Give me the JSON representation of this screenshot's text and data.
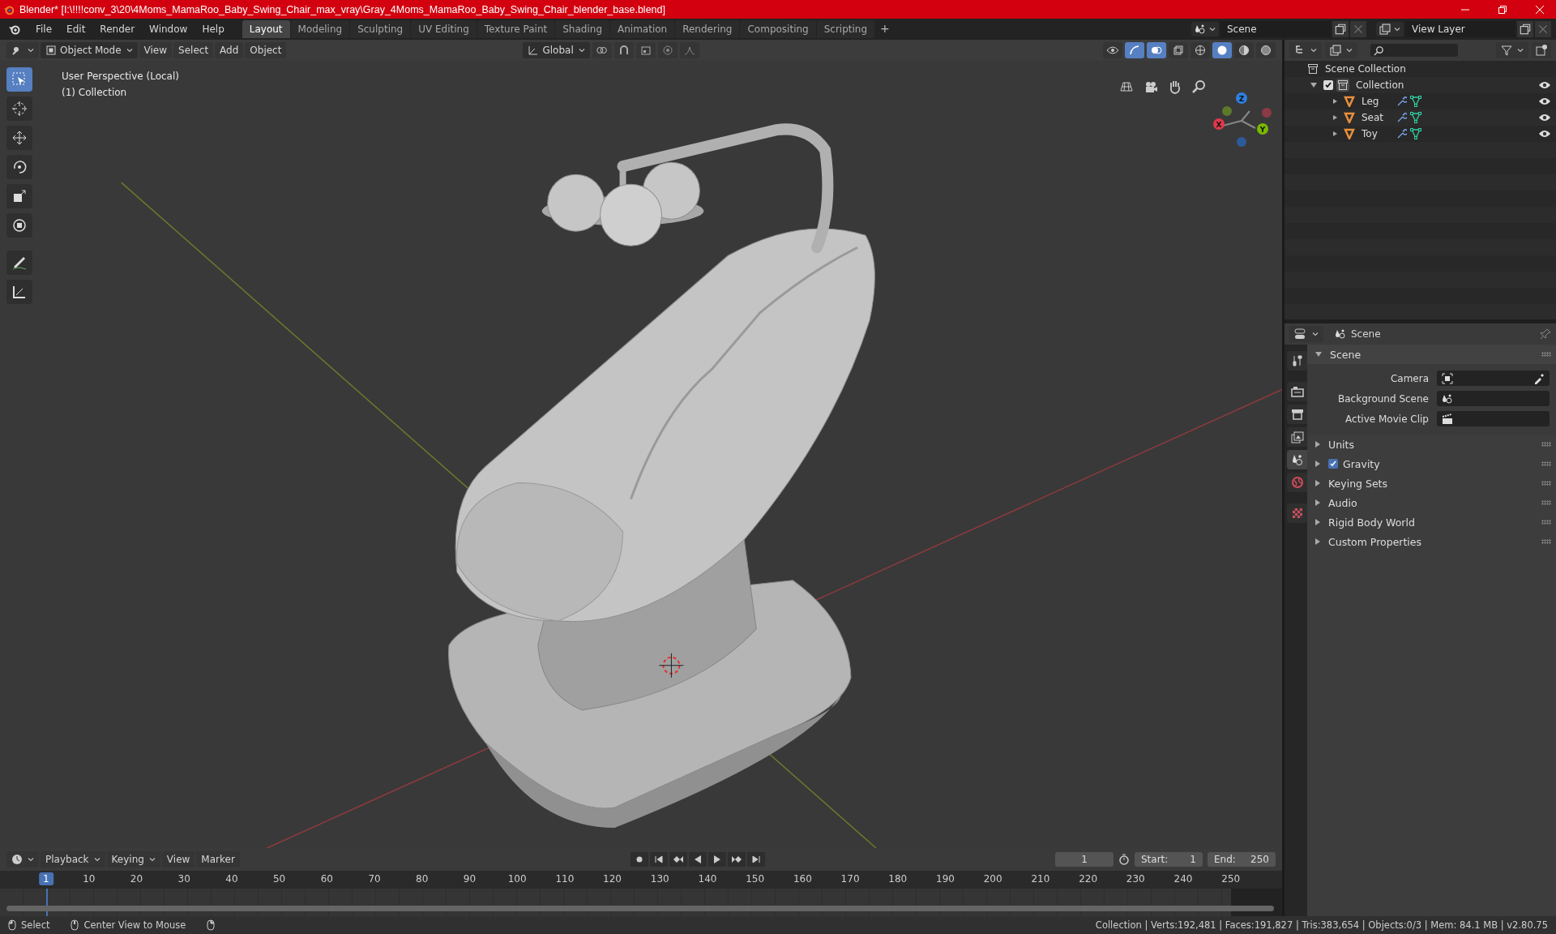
{
  "title_bar": {
    "title": "Blender* [I:\\!!!!conv_3\\20\\4Moms_MamaRoo_Baby_Swing_Chair_max_vray\\Gray_4Moms_MamaRoo_Baby_Swing_Chair_blender_base.blend]"
  },
  "menu": [
    "File",
    "Edit",
    "Render",
    "Window",
    "Help"
  ],
  "workspaces": [
    {
      "label": "Layout",
      "selected": true
    },
    {
      "label": "Modeling",
      "selected": false
    },
    {
      "label": "Sculpting",
      "selected": false
    },
    {
      "label": "UV Editing",
      "selected": false
    },
    {
      "label": "Texture Paint",
      "selected": false
    },
    {
      "label": "Shading",
      "selected": false
    },
    {
      "label": "Animation",
      "selected": false
    },
    {
      "label": "Rendering",
      "selected": false
    },
    {
      "label": "Compositing",
      "selected": false
    },
    {
      "label": "Scripting",
      "selected": false
    }
  ],
  "add_workspace": "+",
  "scene_field": {
    "value": "Scene"
  },
  "view_layer_field": {
    "value": "View Layer"
  },
  "viewport_header": {
    "mode": "Object Mode",
    "menus": [
      "View",
      "Select",
      "Add",
      "Object"
    ],
    "orientation": "Global"
  },
  "viewport": {
    "perspective": "User Perspective (Local)",
    "collection": "(1) Collection",
    "gizmo": {
      "x": "X",
      "y": "Y",
      "z": "Z"
    }
  },
  "toolbar": [
    {
      "kind": "select",
      "selected": true
    },
    {
      "kind": "cursor",
      "selected": false
    },
    {
      "kind": "move",
      "selected": false
    },
    {
      "kind": "rotate",
      "selected": false
    },
    {
      "kind": "scale",
      "selected": false
    },
    {
      "kind": "transform",
      "selected": false
    },
    {
      "kind": "annotate",
      "selected": false
    },
    {
      "kind": "measure",
      "selected": false
    }
  ],
  "outliner": {
    "root": "Scene Collection",
    "items": [
      {
        "label": "Collection",
        "checked": true,
        "expanded": true,
        "children": [
          {
            "label": "Leg",
            "expanded": false
          },
          {
            "label": "Seat",
            "expanded": false
          },
          {
            "label": "Toy",
            "expanded": false
          }
        ]
      }
    ]
  },
  "properties": {
    "header": "Scene",
    "tabs": [
      {
        "kind": "tool",
        "selected": false
      },
      {
        "kind": "render",
        "selected": false
      },
      {
        "kind": "output",
        "selected": false
      },
      {
        "kind": "view_layer",
        "selected": false
      },
      {
        "kind": "scene",
        "selected": true
      },
      {
        "kind": "world",
        "selected": false
      },
      {
        "kind": "texture",
        "selected": false
      }
    ],
    "panel": {
      "title": "Scene",
      "expanded": true,
      "fields": [
        {
          "label": "Camera",
          "kind": "camera"
        },
        {
          "label": "Background Scene",
          "kind": "scene"
        },
        {
          "label": "Active Movie Clip",
          "kind": "clip"
        }
      ]
    },
    "sections": [
      {
        "label": "Units",
        "kind": "plain",
        "expanded": false
      },
      {
        "label": "Gravity",
        "kind": "checkbox",
        "checked": true,
        "expanded": false
      },
      {
        "label": "Keying Sets",
        "kind": "plain",
        "expanded": false
      },
      {
        "label": "Audio",
        "kind": "plain",
        "expanded": false
      },
      {
        "label": "Rigid Body World",
        "kind": "plain",
        "expanded": false
      },
      {
        "label": "Custom Properties",
        "kind": "plain",
        "expanded": false
      }
    ]
  },
  "timeline": {
    "menus": [
      "Playback",
      "Keying",
      "View",
      "Marker"
    ],
    "current_frame": "1",
    "start_label": "Start:",
    "start": "1",
    "end_label": "End:",
    "end": "250",
    "ruler": [
      "1",
      "10",
      "20",
      "30",
      "40",
      "50",
      "60",
      "70",
      "80",
      "90",
      "100",
      "110",
      "120",
      "130",
      "140",
      "150",
      "160",
      "170",
      "180",
      "190",
      "200",
      "210",
      "220",
      "230",
      "240",
      "250"
    ]
  },
  "status_bar": {
    "select": "Select",
    "center": "Center View to Mouse",
    "stats": "Collection | Verts:192,481 | Faces:191,827 | Tris:383,654 | Objects:0/3 | Mem: 84.1 MB | v2.80.75"
  }
}
